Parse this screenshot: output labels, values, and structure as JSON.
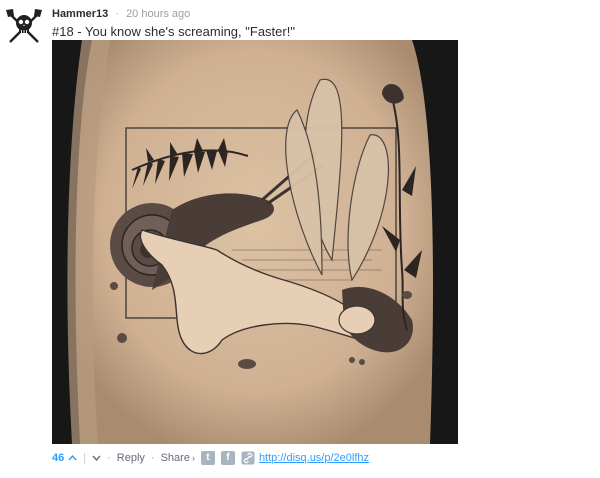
{
  "comment": {
    "author": "Hammer13",
    "separator": "·",
    "time": "20 hours ago",
    "message": "#18 - You know she's screaming, \"Faster!\""
  },
  "footer": {
    "votes": "46",
    "up_icon": "up-arrow",
    "divider": "|",
    "down_icon": "down-arrow",
    "dot1": "·",
    "reply": "Reply",
    "dot2": "·",
    "share": "Share",
    "share_caret": "›",
    "twitter_glyph": "t",
    "facebook_glyph": "f",
    "link_url": "http://disq.us/p/2e0lfhz"
  },
  "colors": {
    "accent_blue": "#2e9fff",
    "muted_text": "#656c7a",
    "social_icon_bg": "#a9b4c2"
  }
}
